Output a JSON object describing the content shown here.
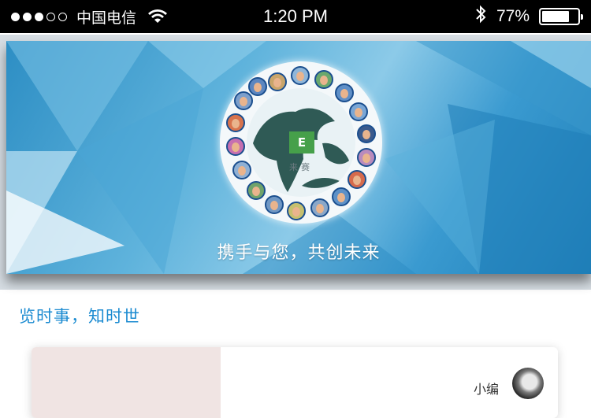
{
  "status_bar": {
    "carrier": "中国电信",
    "time": "1:20 PM",
    "battery_percent": "77%",
    "battery_level": 0.77,
    "signal_bars_filled": 3,
    "signal_bars_total": 5
  },
  "banner": {
    "slogan": "携手与您，共创未来",
    "logo_text": "来赛",
    "logo_letter": "E",
    "logo_color": "#46a04a"
  },
  "section": {
    "title": "览时事，知时世"
  },
  "card": {
    "author": "小编"
  },
  "colors": {
    "accent": "#1b8bd1",
    "banner_blue": "#2d8ec4"
  }
}
